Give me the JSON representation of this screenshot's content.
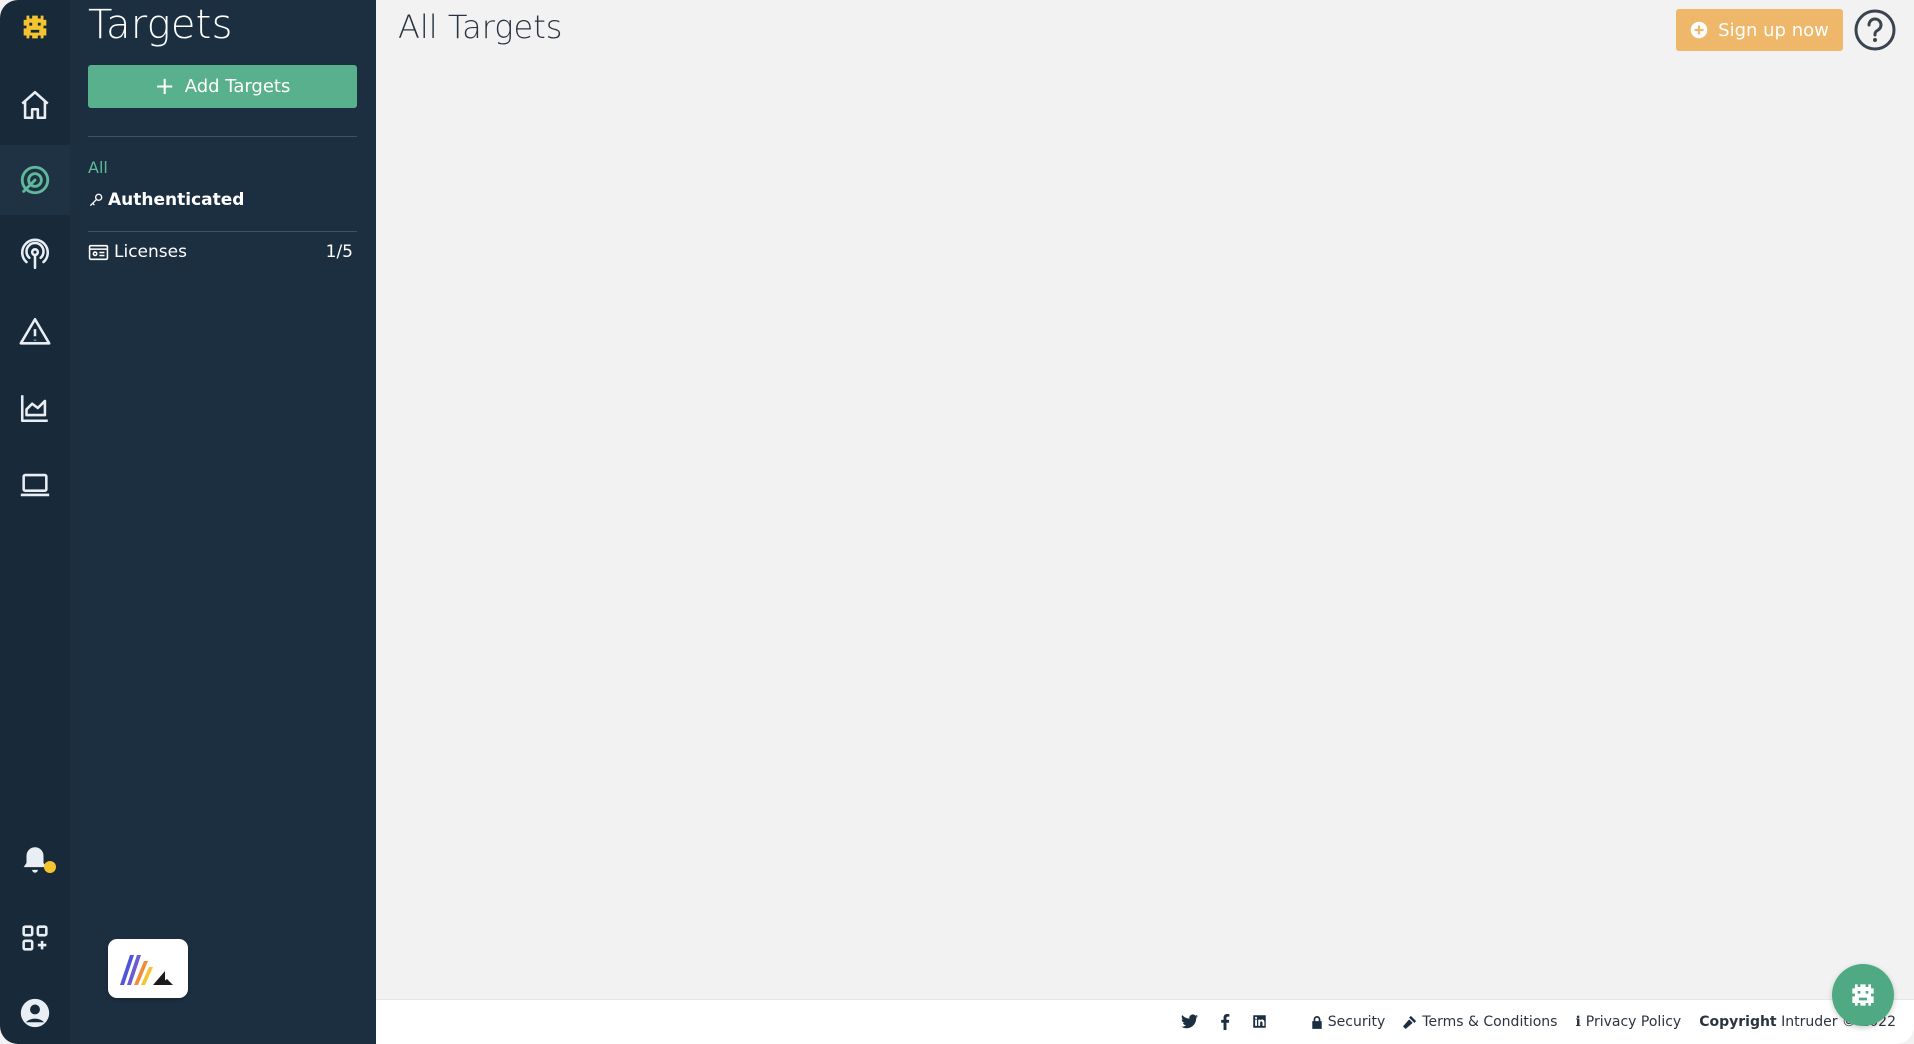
{
  "rail": {
    "items": [
      "logo",
      "home",
      "targets",
      "scans",
      "issues",
      "reports",
      "devices",
      "notifications",
      "integrations",
      "account"
    ]
  },
  "sidebar": {
    "title": "Targets",
    "add_button": "Add Targets",
    "filters": {
      "all": "All",
      "authenticated": "Authenticated"
    },
    "licenses": {
      "label": "Licenses",
      "count": "1/5"
    }
  },
  "main": {
    "title": "All Targets",
    "signup_button": "Sign up now"
  },
  "footer": {
    "security": "Security",
    "terms": "Terms & Conditions",
    "privacy": "Privacy Policy",
    "copyright_bold": "Copyright",
    "copyright_rest": "Intruder © 2022"
  },
  "colors": {
    "rail_bg": "#182a39",
    "sidebar_bg": "#1c2f41",
    "accent_green": "#59b08c",
    "signup_orange": "#efb76a",
    "notification_dot": "#f4c430"
  }
}
